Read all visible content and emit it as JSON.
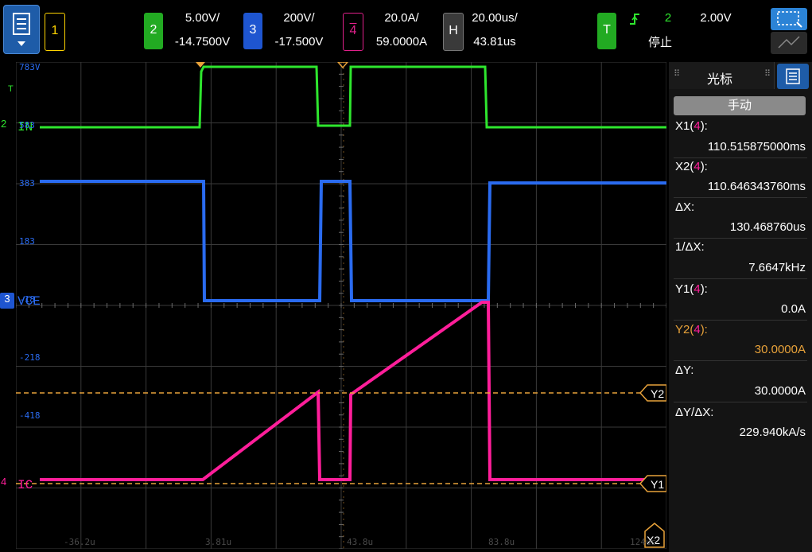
{
  "topbar": {
    "menu_icon": "list-icon",
    "ch1": {
      "num": "1",
      "color": "#ffd400"
    },
    "ch2": {
      "num": "2",
      "color": "#22aa22",
      "scale": "5.00V/",
      "offset": "-14.7500V"
    },
    "ch3": {
      "num": "3",
      "color": "#1e55d0",
      "scale": "200V/",
      "offset": "-17.500V"
    },
    "ch4": {
      "num": "4",
      "color": "#e0208a",
      "scale": "20.0A/",
      "offset": "59.0000A"
    },
    "horiz": {
      "label": "H",
      "scale": "20.00us/",
      "delay": "43.81us"
    },
    "trigger": {
      "label": "T",
      "edge_icon": "rising-edge-icon",
      "source": "2",
      "level": "2.00V",
      "state": "停止"
    },
    "tool_icons": [
      "zoom-box-icon",
      "measure-icon"
    ]
  },
  "screen": {
    "channel_labels": {
      "in": "IN",
      "vce": "VCE",
      "ic": "IC"
    },
    "channel_markers": {
      "t": "T",
      "ch2": "2",
      "ch3": "3",
      "ch4": "4"
    },
    "y_ticks": [
      "783V",
      "583",
      "383",
      "183",
      "-18",
      "-218",
      "-418"
    ],
    "x_ticks": [
      "-36.2u",
      "3.81u",
      "43.8u",
      "83.8u",
      "124us"
    ],
    "cursor_tags": {
      "y2": "Y2",
      "y1": "Y1",
      "x2": "X2"
    },
    "colors": {
      "green": "#2ee62e",
      "blue": "#2a6bf0",
      "pink": "#ff1e9a",
      "cursor": "#e8a23a",
      "grid": "#3a3a3a"
    }
  },
  "panel": {
    "title": "光标",
    "mode_button": "手动",
    "x1_label": "X1(",
    "x1_ch": "4",
    "x1_close": "):",
    "x1_value": "110.515875000ms",
    "x2_label": "X2(",
    "x2_ch": "4",
    "x2_close": "):",
    "x2_value": "110.646343760ms",
    "dx_label": "ΔX:",
    "dx_value": "130.468760us",
    "inv_dx_label": "1/ΔX:",
    "inv_dx_value": "7.6647kHz",
    "y1_label": "Y1(",
    "y1_ch": "4",
    "y1_close": "):",
    "y1_value": "0.0A",
    "y2_label": "Y2(",
    "y2_ch": "4",
    "y2_close": "):",
    "y2_value": "30.0000A",
    "dy_label": "ΔY:",
    "dy_value": "30.0000A",
    "dydx_label": "ΔY/ΔX:",
    "dydx_value": "229.940kA/s"
  }
}
